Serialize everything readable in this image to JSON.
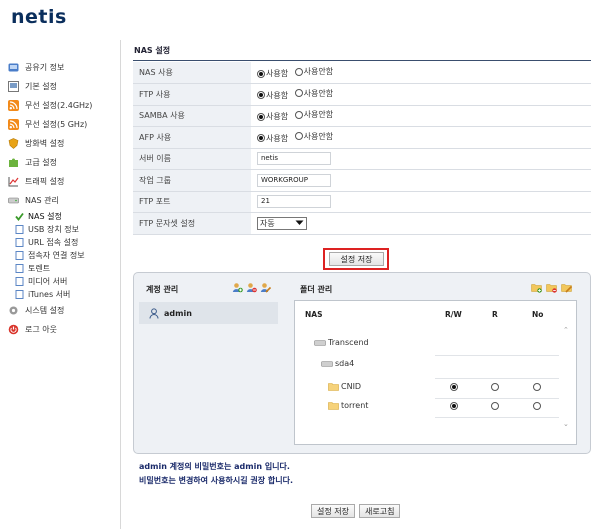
{
  "brand": {
    "logo": "netis"
  },
  "sidebar": {
    "items": [
      {
        "label": "공유기 정보",
        "icon": "router-info-icon"
      },
      {
        "label": "기본 설정",
        "icon": "basic-settings-icon"
      },
      {
        "label": "무선 설정(2.4GHz)",
        "icon": "wifi-icon"
      },
      {
        "label": "무선 설정(5 GHz)",
        "icon": "wifi-icon"
      },
      {
        "label": "방화벽 설정",
        "icon": "firewall-icon"
      },
      {
        "label": "고급 설정",
        "icon": "puzzle-icon"
      },
      {
        "label": "트래픽 설정",
        "icon": "traffic-chart-icon"
      },
      {
        "label": "NAS 관리",
        "icon": "nas-icon"
      }
    ],
    "nas_sub": [
      {
        "label": "NAS 설정",
        "icon": "check-icon",
        "active": true
      },
      {
        "label": "USB 장치 정보",
        "icon": "page-icon"
      },
      {
        "label": "URL 접속 설정",
        "icon": "page-icon"
      },
      {
        "label": "접속자 연결 정보",
        "icon": "page-icon"
      },
      {
        "label": "토렌트",
        "icon": "page-icon"
      },
      {
        "label": "미디어 서버",
        "icon": "page-icon"
      },
      {
        "label": "iTunes 서버",
        "icon": "page-icon"
      }
    ],
    "bottom_items": [
      {
        "label": "시스템 설정",
        "icon": "system-gear-icon"
      },
      {
        "label": "로그 아웃",
        "icon": "logout-icon"
      }
    ]
  },
  "nas_settings": {
    "title": "NAS 설정",
    "rows": [
      {
        "label": "NAS 사용",
        "type": "radio",
        "options": [
          "사용함",
          "사용안함"
        ],
        "selected": 0
      },
      {
        "label": "FTP 사용",
        "type": "radio",
        "options": [
          "사용함",
          "사용안함"
        ],
        "selected": 0
      },
      {
        "label": "SAMBA 사용",
        "type": "radio",
        "options": [
          "사용함",
          "사용안함"
        ],
        "selected": 0
      },
      {
        "label": "AFP 사용",
        "type": "radio",
        "options": [
          "사용함",
          "사용안함"
        ],
        "selected": 0
      },
      {
        "label": "서버 이름",
        "type": "text",
        "value": "netis"
      },
      {
        "label": "작업 그룹",
        "type": "text",
        "value": "WORKGROUP"
      },
      {
        "label": "FTP 포트",
        "type": "text",
        "value": "21"
      },
      {
        "label": "FTP 문자셋 설정",
        "type": "select",
        "value": "자동"
      }
    ],
    "save_button": "설정 저장"
  },
  "account": {
    "title": "계정 관리",
    "users": [
      "admin"
    ]
  },
  "folders": {
    "title": "폴더 관리",
    "columns": {
      "name": "NAS",
      "rw": "R/W",
      "r": "R",
      "no": "No"
    },
    "tree": [
      {
        "label": "Transcend",
        "level": 0,
        "icon": "drive-icon"
      },
      {
        "label": "sda4",
        "level": 1,
        "icon": "drive-icon"
      },
      {
        "label": "CNID",
        "level": 2,
        "icon": "folder-icon",
        "perm": "rw"
      },
      {
        "label": "torrent",
        "level": 2,
        "icon": "folder-icon",
        "perm": "rw"
      }
    ]
  },
  "notes": [
    "admin 계정의 비밀번호는 admin 입니다.",
    "비밀번호는 변경하여 사용하시길 권장 합니다."
  ],
  "footer": {
    "save": "설정 저장",
    "refresh": "새로고침"
  }
}
